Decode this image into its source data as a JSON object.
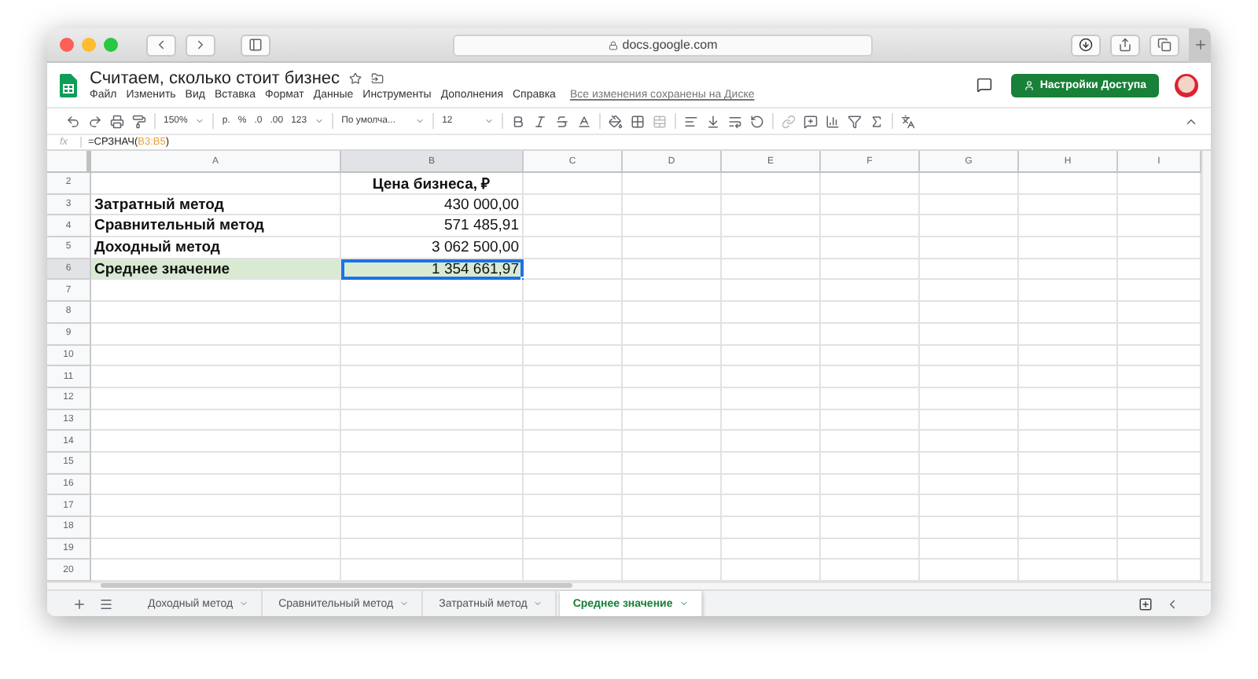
{
  "browser": {
    "url": "docs.google.com"
  },
  "document": {
    "title": "Считаем, сколько стоит бизнес",
    "menus": [
      "Файл",
      "Изменить",
      "Вид",
      "Вставка",
      "Формат",
      "Данные",
      "Инструменты",
      "Дополнения",
      "Справка"
    ],
    "save_status": "Все изменения сохранены на Диске",
    "share_button": "Настройки Доступа"
  },
  "toolbar": {
    "zoom": "150%",
    "currency": "р.",
    "percent": "%",
    "decrease_decimals": ".0",
    "increase_decimals": ".00",
    "number_format": "123",
    "font": "По умолча...",
    "font_size": "12"
  },
  "formula_bar": {
    "label": "fx",
    "prefix": "=СРЗНАЧ(",
    "range": "B3:B5",
    "suffix": ")"
  },
  "columns": [
    {
      "label": "A",
      "selected": false
    },
    {
      "label": "B",
      "selected": true
    },
    {
      "label": "C",
      "selected": false
    },
    {
      "label": "D",
      "selected": false
    },
    {
      "label": "E",
      "selected": false
    },
    {
      "label": "F",
      "selected": false
    },
    {
      "label": "G",
      "selected": false
    },
    {
      "label": "H",
      "selected": false
    },
    {
      "label": "I",
      "selected": false
    }
  ],
  "rows": [
    {
      "number": "2",
      "kind": "header",
      "value": "Цена бизнеса, ₽",
      "selected": false,
      "highlighted": false
    },
    {
      "number": "3",
      "kind": "data",
      "label": "Затратный метод",
      "value": "430 000,00",
      "selected": false,
      "highlighted": false
    },
    {
      "number": "4",
      "kind": "data",
      "label": "Сравнительный метод",
      "value": "571 485,91",
      "selected": false,
      "highlighted": false
    },
    {
      "number": "5",
      "kind": "data",
      "label": "Доходный метод",
      "value": "3 062 500,00",
      "selected": false,
      "highlighted": false
    },
    {
      "number": "6",
      "kind": "data",
      "label": "Среднее значение",
      "value": "1 354 661,97",
      "selected": true,
      "highlighted": true
    },
    {
      "number": "7",
      "kind": "empty",
      "selected": false,
      "highlighted": false
    },
    {
      "number": "8",
      "kind": "empty",
      "selected": false,
      "highlighted": false
    },
    {
      "number": "9",
      "kind": "empty",
      "selected": false,
      "highlighted": false
    },
    {
      "number": "10",
      "kind": "empty",
      "selected": false,
      "highlighted": false
    },
    {
      "number": "11",
      "kind": "empty",
      "selected": false,
      "highlighted": false
    },
    {
      "number": "12",
      "kind": "empty",
      "selected": false,
      "highlighted": false
    },
    {
      "number": "13",
      "kind": "empty",
      "selected": false,
      "highlighted": false
    },
    {
      "number": "14",
      "kind": "empty",
      "selected": false,
      "highlighted": false
    },
    {
      "number": "15",
      "kind": "empty",
      "selected": false,
      "highlighted": false
    },
    {
      "number": "16",
      "kind": "empty",
      "selected": false,
      "highlighted": false
    },
    {
      "number": "17",
      "kind": "empty",
      "selected": false,
      "highlighted": false
    },
    {
      "number": "18",
      "kind": "empty",
      "selected": false,
      "highlighted": false
    },
    {
      "number": "19",
      "kind": "empty",
      "selected": false,
      "highlighted": false
    },
    {
      "number": "20",
      "kind": "empty",
      "selected": false,
      "highlighted": false
    }
  ],
  "sheet_tabs": [
    {
      "label": "Доходный метод",
      "selected": false
    },
    {
      "label": "Сравнительный метод",
      "selected": false
    },
    {
      "label": "Затратный метод",
      "selected": false
    },
    {
      "label": "Среднее значение",
      "selected": true
    }
  ]
}
